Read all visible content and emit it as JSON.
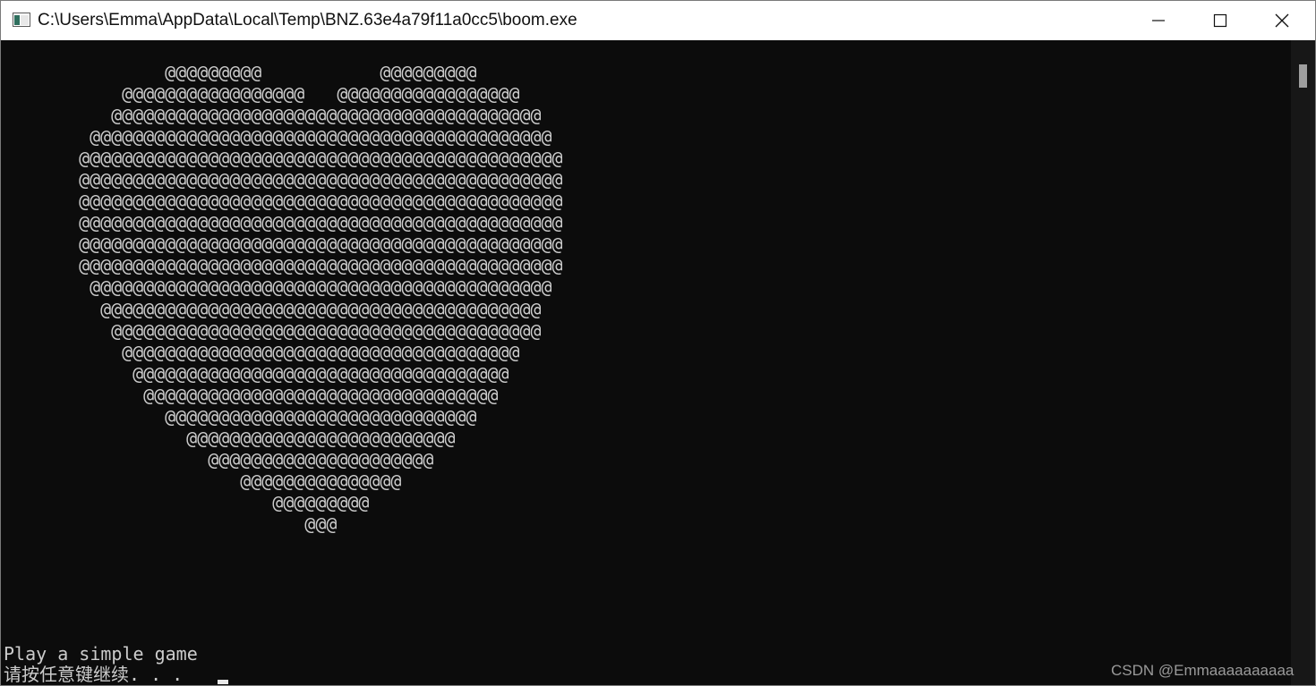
{
  "window": {
    "title": "C:\\Users\\Emma\\AppData\\Local\\Temp\\BNZ.63e4a79f11a0cc5\\boom.exe",
    "icon": "console-window-icon",
    "controls": [
      "minimize-icon",
      "maximize-icon",
      "close-icon"
    ]
  },
  "console": {
    "heart_art": [
      "               @@@@@@@@@           @@@@@@@@@",
      "           @@@@@@@@@@@@@@@@@   @@@@@@@@@@@@@@@@@",
      "          @@@@@@@@@@@@@@@@@@@@@@@@@@@@@@@@@@@@@@@@",
      "        @@@@@@@@@@@@@@@@@@@@@@@@@@@@@@@@@@@@@@@@@@@",
      "       @@@@@@@@@@@@@@@@@@@@@@@@@@@@@@@@@@@@@@@@@@@@@",
      "       @@@@@@@@@@@@@@@@@@@@@@@@@@@@@@@@@@@@@@@@@@@@@",
      "       @@@@@@@@@@@@@@@@@@@@@@@@@@@@@@@@@@@@@@@@@@@@@",
      "       @@@@@@@@@@@@@@@@@@@@@@@@@@@@@@@@@@@@@@@@@@@@@",
      "       @@@@@@@@@@@@@@@@@@@@@@@@@@@@@@@@@@@@@@@@@@@@@",
      "       @@@@@@@@@@@@@@@@@@@@@@@@@@@@@@@@@@@@@@@@@@@@@",
      "        @@@@@@@@@@@@@@@@@@@@@@@@@@@@@@@@@@@@@@@@@@@",
      "         @@@@@@@@@@@@@@@@@@@@@@@@@@@@@@@@@@@@@@@@@",
      "          @@@@@@@@@@@@@@@@@@@@@@@@@@@@@@@@@@@@@@@@",
      "           @@@@@@@@@@@@@@@@@@@@@@@@@@@@@@@@@@@@@",
      "            @@@@@@@@@@@@@@@@@@@@@@@@@@@@@@@@@@@",
      "             @@@@@@@@@@@@@@@@@@@@@@@@@@@@@@@@@",
      "               @@@@@@@@@@@@@@@@@@@@@@@@@@@@@",
      "                 @@@@@@@@@@@@@@@@@@@@@@@@@",
      "                   @@@@@@@@@@@@@@@@@@@@@",
      "                      @@@@@@@@@@@@@@@",
      "                         @@@@@@@@@",
      "                            @@@"
    ],
    "game_line": "Play a simple game",
    "prompt_line": "请按任意键继续. . ."
  },
  "watermark": "CSDN @Emmaaaaaaaaaa",
  "colors": {
    "console_bg": "#0c0c0c",
    "console_text": "#cccccc",
    "titlebar_bg": "#ffffff"
  }
}
